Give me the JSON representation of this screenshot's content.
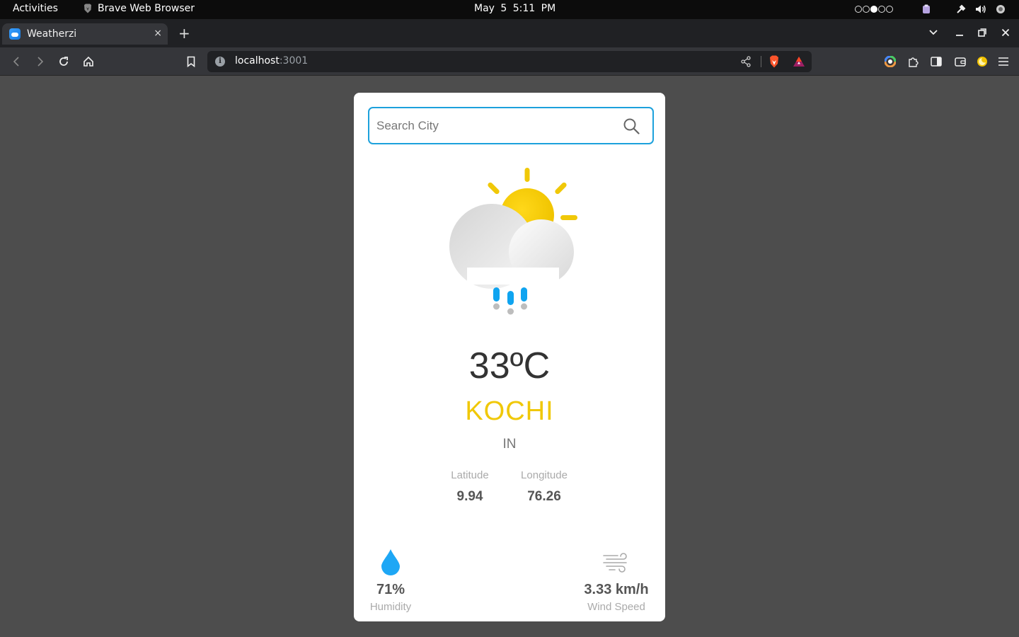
{
  "topbar": {
    "activities": "Activities",
    "app_name": "Brave Web Browser",
    "date": "May 5",
    "time": "5:11 PM"
  },
  "tab": {
    "title": "Weatherzi",
    "close": "×",
    "new_tab": "+"
  },
  "address": {
    "host": "localhost",
    "port": ":3001",
    "info": "i"
  },
  "search": {
    "placeholder": "Search City",
    "value": ""
  },
  "weather": {
    "icon": "sun-cloud-rain-icon",
    "temperature": "33ºC",
    "city": "KOCHI",
    "country": "IN"
  },
  "coordinates": {
    "latitude_label": "Latitude",
    "latitude": "9.94",
    "longitude_label": "Longitude",
    "longitude": "76.26"
  },
  "stats": {
    "humidity": "71%",
    "humidity_label": "Humidity",
    "wind_speed": "3.33 km/h",
    "wind_label": "Wind Speed"
  },
  "colors": {
    "accent_city": "#f0c808",
    "search_border": "#1da1dc",
    "humidity_drop": "#1ea7f5",
    "page_bg": "#4d4d4d"
  }
}
